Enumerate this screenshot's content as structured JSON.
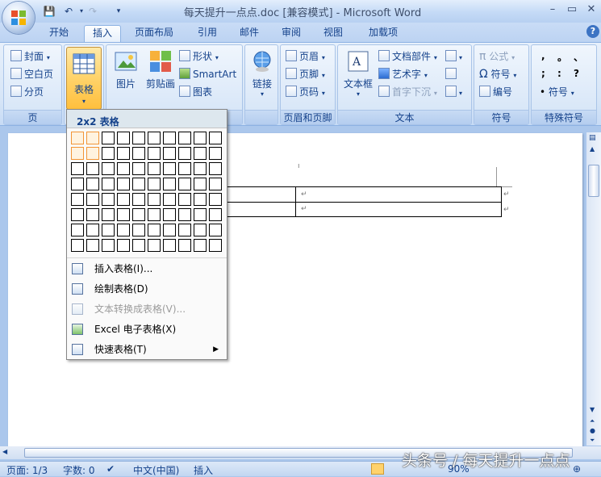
{
  "window": {
    "title": "每天提升一点点.doc [兼容模式] - Microsoft Word"
  },
  "tabs": [
    "开始",
    "插入",
    "页面布局",
    "引用",
    "邮件",
    "审阅",
    "视图",
    "加载项"
  ],
  "ribbon": {
    "pages": {
      "label": "页",
      "items": [
        "封面",
        "空白页",
        "分页"
      ]
    },
    "table": {
      "label": "表格"
    },
    "illustrations": {
      "picture": "图片",
      "clipart": "剪贴画",
      "shapes": "形状",
      "smartart": "SmartArt",
      "chart": "图表"
    },
    "links": {
      "label": "链接"
    },
    "header_footer": {
      "label": "页眉和页脚",
      "items": [
        "页眉",
        "页脚",
        "页码"
      ]
    },
    "text": {
      "label": "文本",
      "textbox": "文本框",
      "parts": "文档部件",
      "wordart": "艺术字",
      "dropcap": "首字下沉"
    },
    "symbols": {
      "label": "符号",
      "items": [
        "公式",
        "符号",
        "编号"
      ]
    },
    "special": {
      "label": "特殊符号",
      "chars": [
        ",",
        "。",
        "、",
        ";",
        ":",
        "?",
        "符号"
      ]
    }
  },
  "dropdown": {
    "header": "2x2 表格",
    "grid_rows": 8,
    "grid_cols": 10,
    "selected_rows": 2,
    "selected_cols": 2,
    "items": [
      {
        "label": "插入表格(I)...",
        "icon": "insert-table-icon",
        "enabled": true
      },
      {
        "label": "绘制表格(D)",
        "icon": "draw-table-icon",
        "enabled": true
      },
      {
        "label": "文本转换成表格(V)...",
        "icon": "convert-text-icon",
        "enabled": false
      },
      {
        "label": "Excel 电子表格(X)",
        "icon": "excel-icon",
        "enabled": true
      },
      {
        "label": "快速表格(T)",
        "icon": "quick-table-icon",
        "enabled": true,
        "submenu": true
      }
    ]
  },
  "statusbar": {
    "page": "页面: 1/3",
    "words": "字数: 0",
    "language": "中文(中国)",
    "mode": "插入",
    "zoom": "90%"
  },
  "watermark": "头条号 / 每天提升一点点"
}
